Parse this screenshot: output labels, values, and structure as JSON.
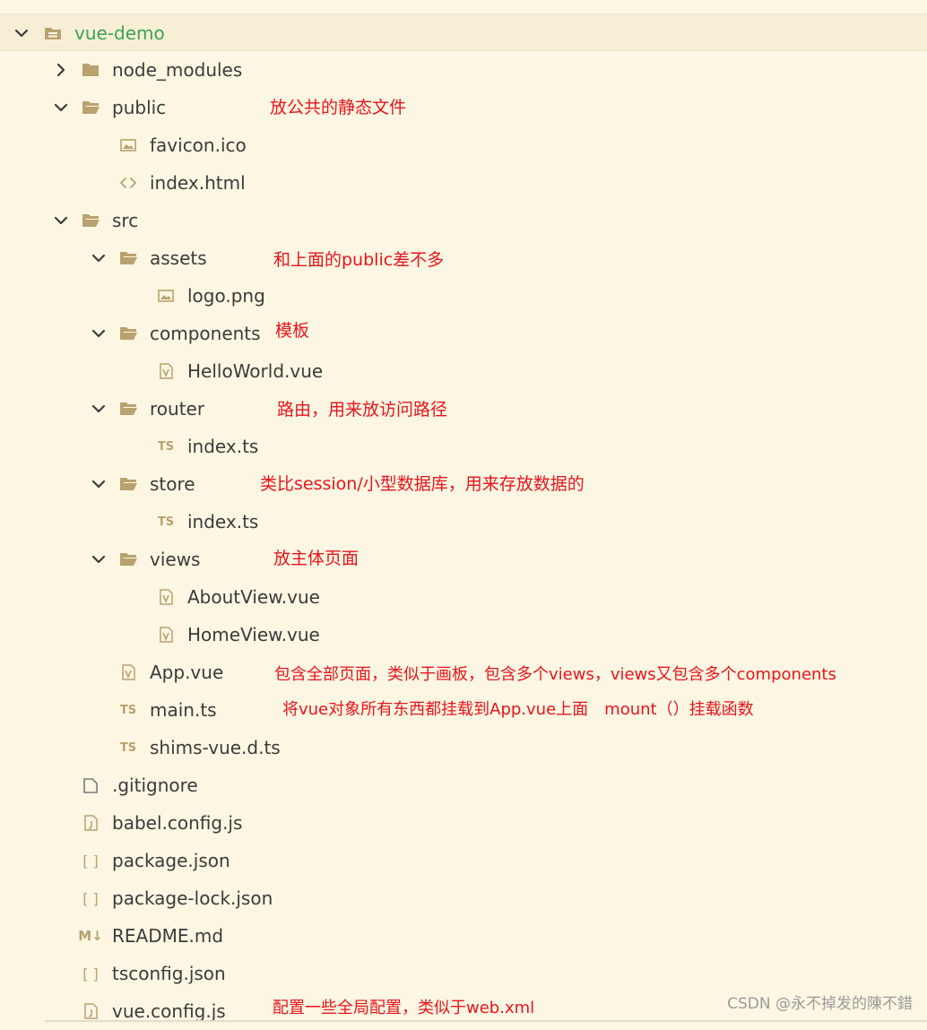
{
  "root": {
    "label": "vue-demo"
  },
  "tree": {
    "node_modules": "node_modules",
    "public": "public",
    "favicon": "favicon.ico",
    "index_html": "index.html",
    "src": "src",
    "assets": "assets",
    "logo": "logo.png",
    "components": "components",
    "helloworld": "HelloWorld.vue",
    "router": "router",
    "router_index": "index.ts",
    "store": "store",
    "store_index": "index.ts",
    "views": "views",
    "aboutview": "AboutView.vue",
    "homeview": "HomeView.vue",
    "app_vue": "App.vue",
    "main_ts": "main.ts",
    "shims": "shims-vue.d.ts",
    "gitignore": ".gitignore",
    "babel": "babel.config.js",
    "package_json": "package.json",
    "package_lock": "package-lock.json",
    "readme": "README.md",
    "tsconfig": "tsconfig.json",
    "vue_config": "vue.config.js"
  },
  "annotations": {
    "public": "放公共的静态文件",
    "assets": "和上面的public差不多",
    "components": "模板",
    "router": "路由，用来放访问路径",
    "store": "类比session/小型数据库，用来存放数据的",
    "views": "放主体页面",
    "app_vue": "包含全部页面，类似于画板，包含多个views，views又包含多个components",
    "main_ts": "将vue对象所有东西都挂载到App.vue上面　mount（）挂载函数",
    "vue_config": "配置一些全局配置，类似于web.xml"
  },
  "icon_glyphs": {
    "ts": "TS",
    "json": "[ ]",
    "markdown": "M↓"
  },
  "watermark": "CSDN @永不掉发的陳不錯",
  "colors": {
    "background": "#fdf6e3",
    "selected_row": "#f6efd6",
    "root_label": "#3fa056",
    "label": "#3b3b3b",
    "icon": "#b8a26e",
    "annotation": "#e8151b",
    "watermark": "#9a9a9a"
  }
}
